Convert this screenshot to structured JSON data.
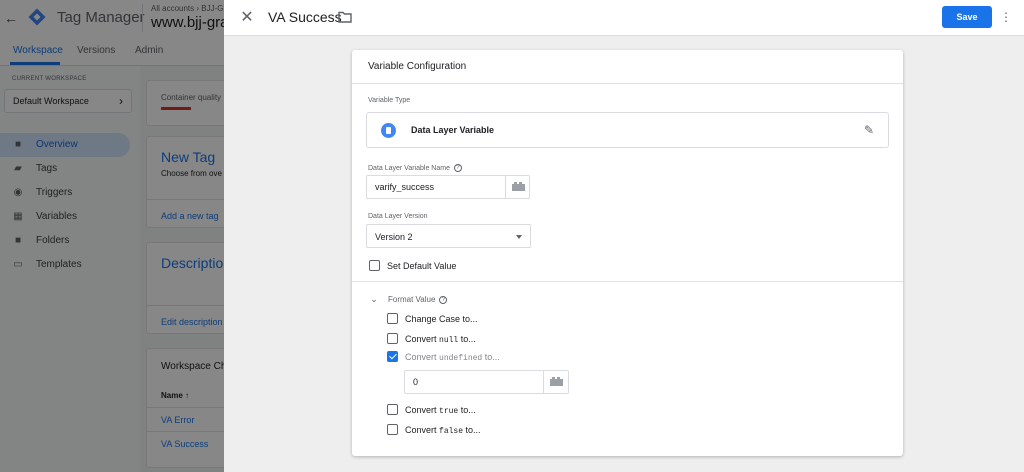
{
  "app": {
    "name": "Tag Manager",
    "account_crumb": "All accounts › BJJ-Gr",
    "account_url": "www.bjj-gra"
  },
  "nav_tabs": [
    {
      "label": "Workspace",
      "active": true
    },
    {
      "label": "Versions",
      "active": false
    },
    {
      "label": "Admin",
      "active": false
    }
  ],
  "sidebar": {
    "current_workspace_label": "CURRENT WORKSPACE",
    "workspace_name": "Default Workspace",
    "items": [
      {
        "label": "Overview",
        "icon": "folder-icon",
        "active": true
      },
      {
        "label": "Tags",
        "icon": "tag-icon",
        "active": false
      },
      {
        "label": "Triggers",
        "icon": "trigger-icon",
        "active": false
      },
      {
        "label": "Variables",
        "icon": "variables-icon",
        "active": false
      },
      {
        "label": "Folders",
        "icon": "folder-icon",
        "active": false
      },
      {
        "label": "Templates",
        "icon": "template-icon",
        "active": false
      }
    ]
  },
  "overview": {
    "container_quality": "Container quality",
    "new_tag_title": "New Tag",
    "new_tag_sub": "Choose from ove",
    "add_new_tag": "Add a new tag",
    "description_title": "Description",
    "edit_description": "Edit description",
    "workspace_changes": "Workspace Ch",
    "name_col": "Name ↑",
    "rows": [
      "VA Error",
      "VA Success"
    ]
  },
  "panel": {
    "title": "VA Success",
    "save_label": "Save"
  },
  "config": {
    "title": "Variable Configuration",
    "variable_type_label": "Variable Type",
    "variable_type": "Data Layer Variable",
    "dlv_name_label": "Data Layer Variable Name",
    "dlv_name_value": "varify_success",
    "dlv_version_label": "Data Layer Version",
    "dlv_version_value": "Version 2",
    "set_default_label": "Set Default Value",
    "set_default_checked": false,
    "format_value_label": "Format Value",
    "format_options": [
      {
        "prefix": "Change Case to...",
        "code": "",
        "suffix": "",
        "checked": false
      },
      {
        "prefix": "Convert ",
        "code": "null",
        "suffix": " to...",
        "checked": false
      },
      {
        "prefix": "Convert ",
        "code": "undefined",
        "suffix": " to...",
        "checked": true
      },
      {
        "prefix": "Convert ",
        "code": "true",
        "suffix": " to...",
        "checked": false
      },
      {
        "prefix": "Convert ",
        "code": "false",
        "suffix": " to...",
        "checked": false
      }
    ],
    "undefined_value": "0"
  },
  "colors": {
    "accent": "#1a73e8",
    "active_nav_bg": "#d2e3fc"
  }
}
